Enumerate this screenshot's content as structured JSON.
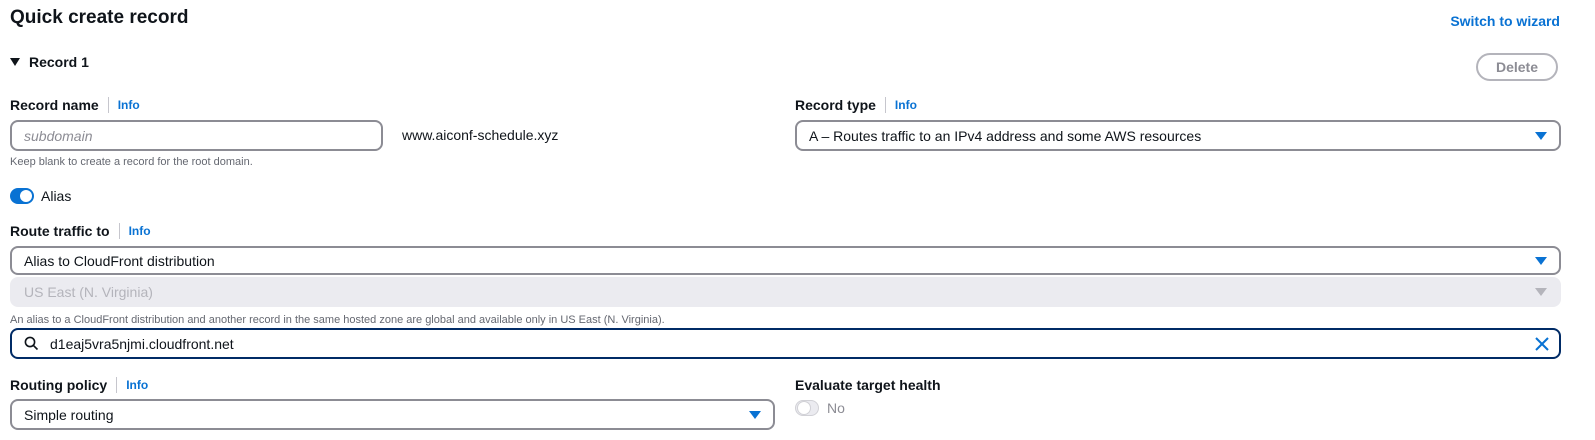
{
  "header": {
    "title": "Quick create record",
    "switch_link": "Switch to wizard"
  },
  "record": {
    "heading": "Record 1",
    "delete_label": "Delete",
    "record_name": {
      "label": "Record name",
      "info": "Info",
      "placeholder": "subdomain",
      "domain_suffix": "www.aiconf-schedule.xyz",
      "hint": "Keep blank to create a record for the root domain."
    },
    "record_type": {
      "label": "Record type",
      "info": "Info",
      "value": "A – Routes traffic to an IPv4 address and some AWS resources"
    },
    "alias": {
      "label": "Alias",
      "enabled": true
    },
    "route_traffic": {
      "label": "Route traffic to",
      "info": "Info",
      "endpoint_value": "Alias to CloudFront distribution",
      "region_value": "US East (N. Virginia)",
      "region_hint": "An alias to a CloudFront distribution and another record in the same hosted zone are global and available only in US East (N. Virginia).",
      "search_value": "d1eaj5vra5njmi.cloudfront.net"
    },
    "routing_policy": {
      "label": "Routing policy",
      "info": "Info",
      "value": "Simple routing"
    },
    "evaluate_health": {
      "label": "Evaluate target health",
      "value_label": "No",
      "enabled": false
    }
  },
  "icons": {
    "search": "search-icon",
    "clear": "close-icon",
    "dropdown": "caret-down-icon",
    "expand": "caret-down-icon"
  },
  "colors": {
    "accent": "#0972d3",
    "text": "#0f141a",
    "muted": "#656871",
    "focus_border": "#002b66"
  }
}
